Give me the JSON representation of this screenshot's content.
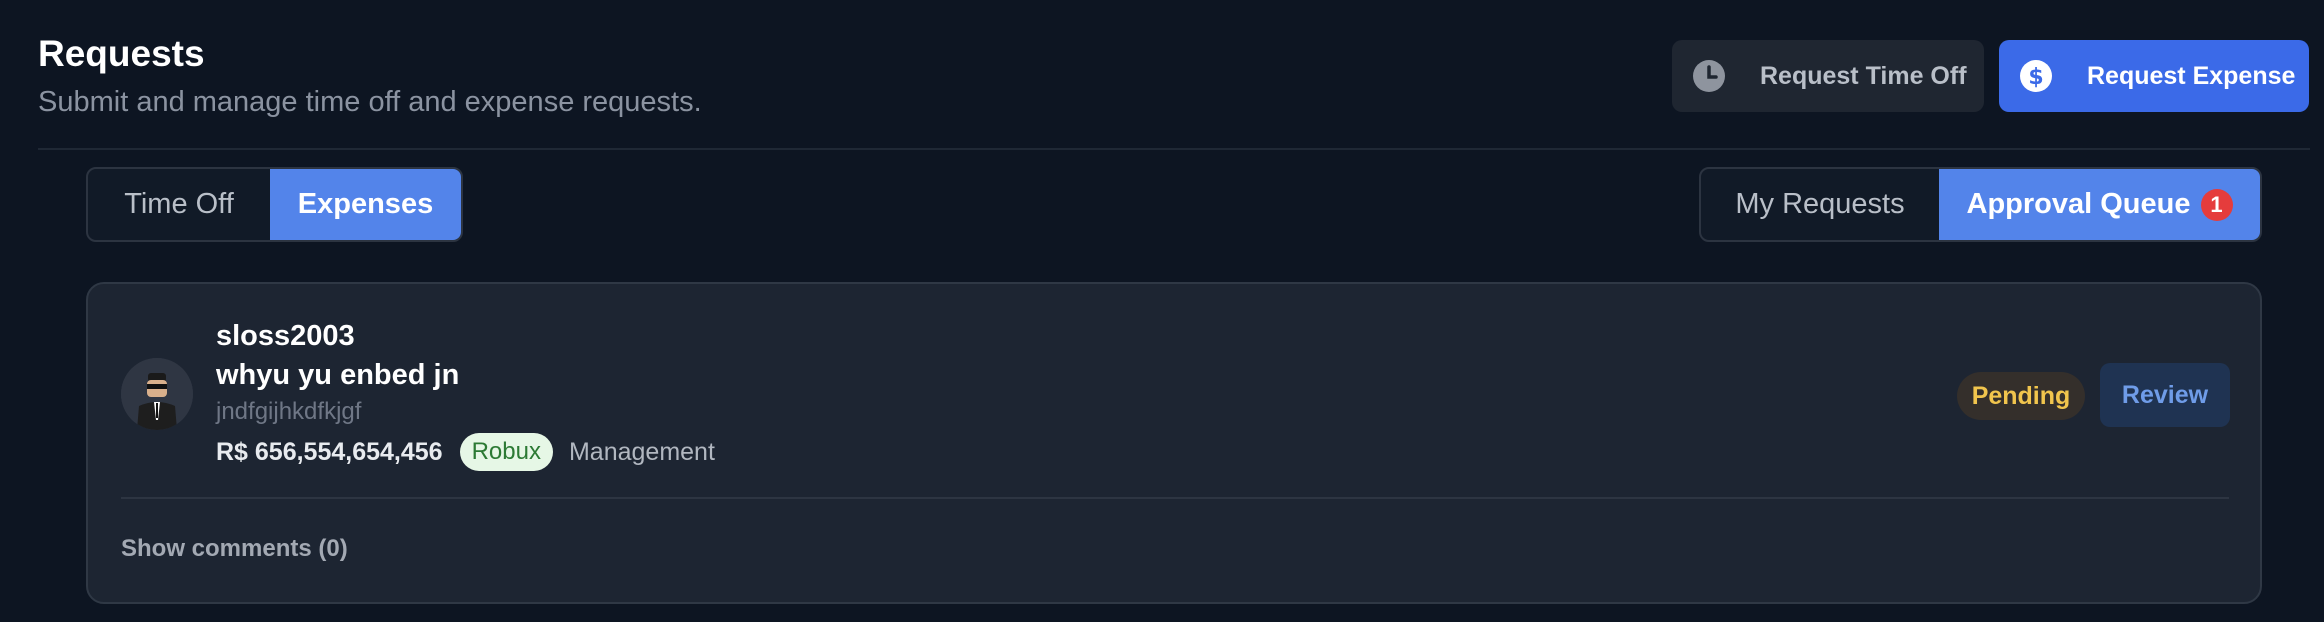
{
  "header": {
    "title": "Requests",
    "subtitle": "Submit and manage time off and expense requests.",
    "request_time_off_label": "Request Time Off",
    "request_expense_label": "Request Expense"
  },
  "type_tabs": [
    {
      "label": "Time Off",
      "active": false
    },
    {
      "label": "Expenses",
      "active": true
    }
  ],
  "view_tabs": [
    {
      "label": "My Requests",
      "active": false
    },
    {
      "label": "Approval Queue",
      "active": true,
      "badge": "1"
    }
  ],
  "request": {
    "username": "sloss2003",
    "title": "whyu yu enbed jn",
    "description": "jndfgijhkdfkjgf",
    "amount": "R$ 656,554,654,456",
    "currency": "Robux",
    "category": "Management",
    "status": "Pending",
    "review_label": "Review",
    "comments_label": "Show comments (0)"
  },
  "colors": {
    "background": "#0d1522",
    "card": "#1d2532",
    "accent": "#3b6ae8",
    "tab_active": "#5384ea",
    "badge_red": "#e53c3c",
    "pending": "#f1c54d",
    "currency_green": "#2c7a34"
  },
  "icons": {
    "request_time_off": "clock-icon",
    "request_expense": "dollar-circle-icon"
  }
}
